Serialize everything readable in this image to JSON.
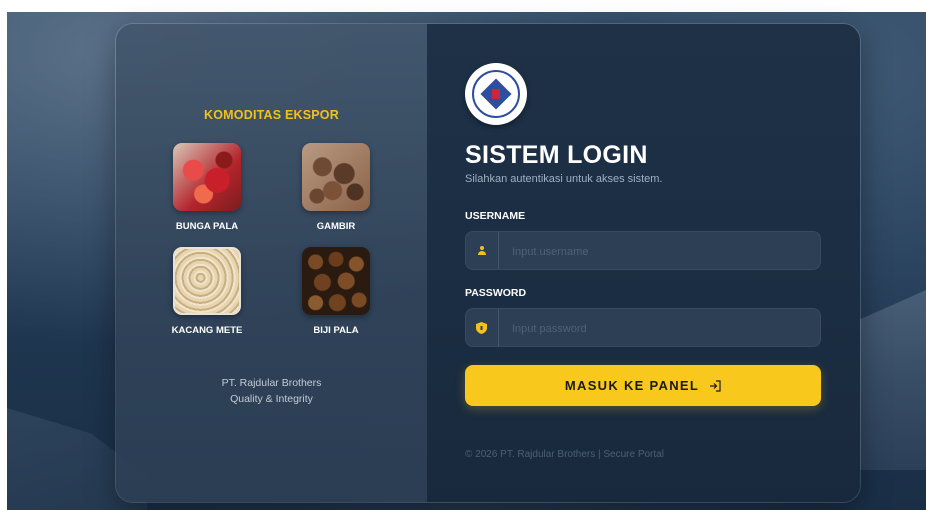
{
  "commodities": {
    "title": "KOMODITAS EKSPOR",
    "items": [
      {
        "label": "BUNGA PALA"
      },
      {
        "label": "GAMBIR"
      },
      {
        "label": "KACANG METE"
      },
      {
        "label": "BIJI PALA"
      }
    ]
  },
  "company": {
    "name": "PT. Rajdular Brothers",
    "tagline": "Quality & Integrity"
  },
  "login": {
    "title": "SISTEM LOGIN",
    "subtitle": "Silahkan autentikasi untuk akses sistem.",
    "username_label": "USERNAME",
    "username_placeholder": "Input username",
    "username_icon": "user-icon",
    "password_label": "PASSWORD",
    "password_placeholder": "Input password",
    "password_icon": "shield-icon",
    "submit_label": "MASUK KE PANEL",
    "submit_icon": "login-icon",
    "footer": "© 2026 PT. Rajdular Brothers | Secure Portal"
  },
  "colors": {
    "accent": "#f8c81c",
    "title_accent": "#f2c21a",
    "panel_right": "#1e3147"
  }
}
